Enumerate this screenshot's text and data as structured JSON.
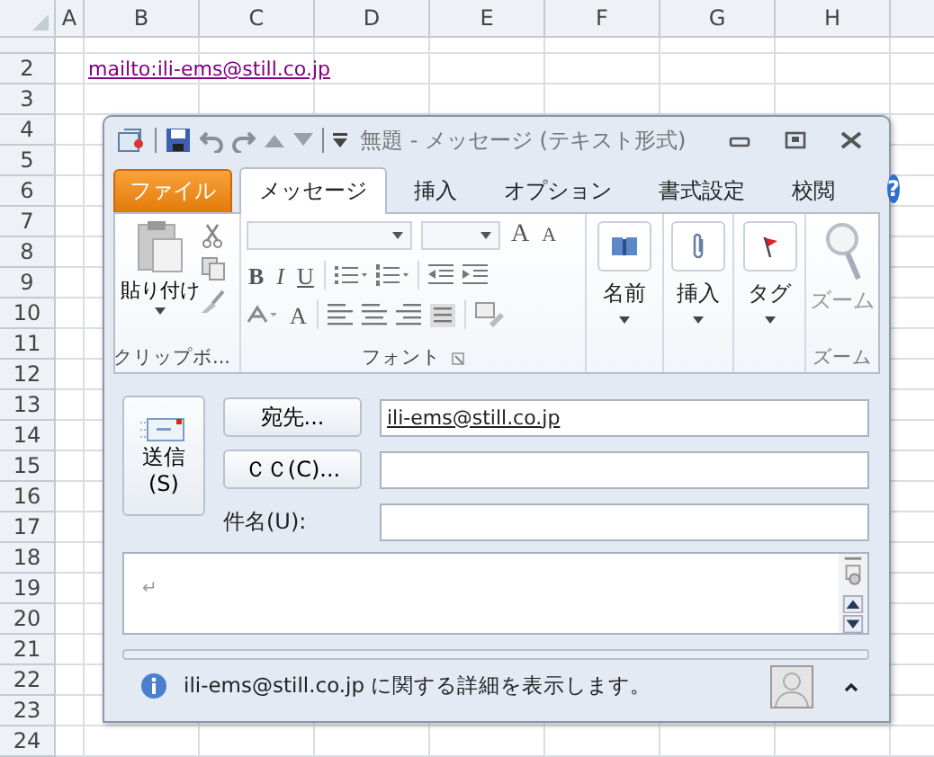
{
  "spreadsheet": {
    "columns": [
      "A",
      "B",
      "C",
      "D",
      "E",
      "F",
      "G",
      "H"
    ],
    "rows": [
      "2",
      "3",
      "4",
      "5",
      "6",
      "7",
      "8",
      "9",
      "10",
      "11",
      "12",
      "13",
      "14",
      "15",
      "16",
      "17",
      "18",
      "19",
      "20",
      "21",
      "22",
      "23",
      "24"
    ],
    "link": "mailto:ili-ems@still.co.jp"
  },
  "window": {
    "title": "無題 - メッセージ (テキスト形式)",
    "tabs": [
      {
        "label": "ファイル",
        "kind": "file",
        "selected": false
      },
      {
        "label": "メッセージ",
        "kind": "tab",
        "selected": true
      },
      {
        "label": "挿入",
        "kind": "tab",
        "selected": false
      },
      {
        "label": "オプション",
        "kind": "tab",
        "selected": false
      },
      {
        "label": "書式設定",
        "kind": "tab",
        "selected": false
      },
      {
        "label": "校閲",
        "kind": "tab",
        "selected": false
      }
    ],
    "help": "?",
    "groups": [
      {
        "kind": "clipboard",
        "button": "貼り付け",
        "label": "クリップボ..."
      },
      {
        "kind": "font",
        "format": [
          "B",
          "I",
          "U"
        ],
        "size": [
          "A",
          "A"
        ],
        "font_color_button": "A",
        "label": "フォント"
      },
      {
        "kind": "names",
        "button": "名前"
      },
      {
        "kind": "insert",
        "button": "挿入"
      },
      {
        "kind": "tags",
        "button": "タグ"
      },
      {
        "kind": "zoom",
        "button": "ズーム",
        "label": "ズーム",
        "disabled": true
      }
    ],
    "send": [
      "送信",
      "(S)"
    ],
    "to_button": "宛先...",
    "to_value": "ili-ems@still.co.jp",
    "cc_button": "ＣＣ(C)...",
    "subject_label": "件名(U):",
    "body_mark": "↵",
    "people": "ili-ems@still.co.jp に関する詳細を表示します。"
  }
}
